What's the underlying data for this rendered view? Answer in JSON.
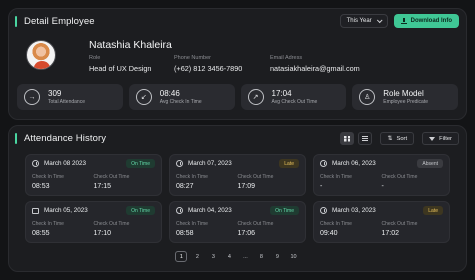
{
  "detail": {
    "title": "Detail Employee",
    "period_select": "This Year",
    "download_label": "Download Info",
    "name": "Natashia Khaleira",
    "fields": [
      {
        "label": "Role",
        "value": "Head of UX Design"
      },
      {
        "label": "Phone Number",
        "value": "(+62) 812 3456-7890"
      },
      {
        "label": "Email Adress",
        "value": "natasiakhaleira@gmail.com"
      }
    ],
    "stats": [
      {
        "icon": "login-arrow-icon",
        "glyph": "→",
        "value": "309",
        "label": "Total Attendance"
      },
      {
        "icon": "check-in-icon",
        "glyph": "↙",
        "value": "08:46",
        "label": "Avg Check In Time"
      },
      {
        "icon": "check-out-icon",
        "glyph": "↗",
        "value": "17:04",
        "label": "Avg Check Out Time"
      },
      {
        "icon": "role-model-icon",
        "glyph": "♙",
        "value": "Role Model",
        "label": "Employee Predicate"
      }
    ]
  },
  "history": {
    "title": "Attendance History",
    "sort_label": "Sort",
    "filter_label": "Filter",
    "check_in_label": "Check In Time",
    "check_out_label": "Check Out Time",
    "records": [
      {
        "date": "March 08 2023",
        "status": "On Time",
        "status_type": "ontime",
        "icon": "clock",
        "check_in": "08:53",
        "check_out": "17:15"
      },
      {
        "date": "March 07, 2023",
        "status": "Late",
        "status_type": "late",
        "icon": "clock",
        "check_in": "08:27",
        "check_out": "17:09"
      },
      {
        "date": "March 06, 2023",
        "status": "Absent",
        "status_type": "absent",
        "icon": "clock",
        "check_in": "-",
        "check_out": "-"
      },
      {
        "date": "March 05, 2023",
        "status": "On Time",
        "status_type": "ontime",
        "icon": "calendar",
        "check_in": "08:55",
        "check_out": "17:10"
      },
      {
        "date": "March 04, 2023",
        "status": "On Time",
        "status_type": "ontime",
        "icon": "clock",
        "check_in": "08:58",
        "check_out": "17:06"
      },
      {
        "date": "March 03, 2023",
        "status": "Late",
        "status_type": "late",
        "icon": "clock",
        "check_in": "09:40",
        "check_out": "17:02"
      }
    ],
    "pages": [
      "1",
      "2",
      "3",
      "4",
      "...",
      "8",
      "9",
      "10"
    ],
    "current_page": "1"
  },
  "colors": {
    "accent": "#3fc795",
    "background": "#131416",
    "card": "#1c1d20"
  }
}
